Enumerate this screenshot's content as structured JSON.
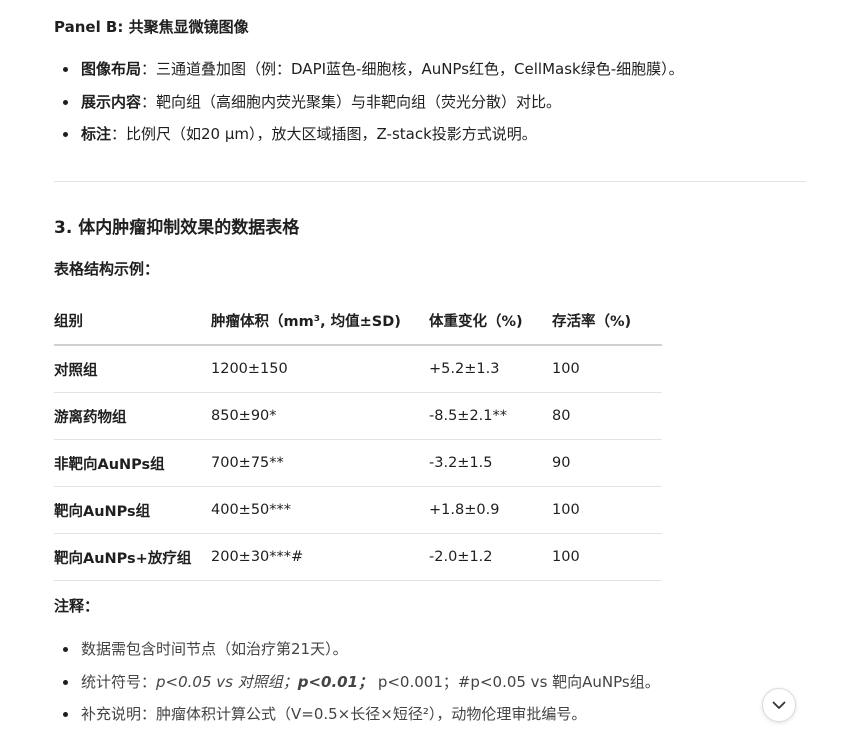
{
  "panel_b": {
    "title": "Panel B: 共聚焦显微镜图像",
    "items": [
      {
        "label": "图像布局",
        "text": "：三通道叠加图（例：DAPI蓝色-细胞核，AuNPs红色，CellMask绿色-细胞膜）。"
      },
      {
        "label": "展示内容",
        "text": "：靶向组（高细胞内荧光聚集）与非靶向组（荧光分散）对比。"
      },
      {
        "label": "标注",
        "text": "：比例尺（如20 μm），放大区域插图，Z-stack投影方式说明。"
      }
    ]
  },
  "section3": {
    "heading": "3. 体内肿瘤抑制效果的数据表格",
    "table_caption": "表格结构示例：",
    "table": {
      "headers": [
        "组别",
        "肿瘤体积（mm³, 均值±SD)",
        "体重变化（%)",
        "存活率（%)"
      ],
      "rows": [
        [
          "对照组",
          "1200±150",
          "+5.2±1.3",
          "100"
        ],
        [
          "游离药物组",
          "850±90*",
          "-8.5±2.1**",
          "80"
        ],
        [
          "非靶向AuNPs组",
          "700±75**",
          "-3.2±1.5",
          "90"
        ],
        [
          "靶向AuNPs组",
          "400±50***",
          "+1.8±0.9",
          "100"
        ],
        [
          "靶向AuNPs+放疗组",
          "200±30***#",
          "-2.0±1.2",
          "100"
        ]
      ]
    },
    "notes_caption": "注释：",
    "notes": {
      "n1": "数据需包含时间节点（如治疗第21天）。",
      "n2_prefix": "统计符号：",
      "n2_italic": "p<0.05 vs 对照组；",
      "n2_bold_italic": "p<0.01；",
      "n2_rest": " p<0.001；#p<0.05 vs 靶向AuNPs组。",
      "n3": "补充说明：肿瘤体积计算公式（V=0.5×长径×短径²），动物伦理审批编号。"
    }
  },
  "scroll_button_icon": "chevron-down-icon"
}
